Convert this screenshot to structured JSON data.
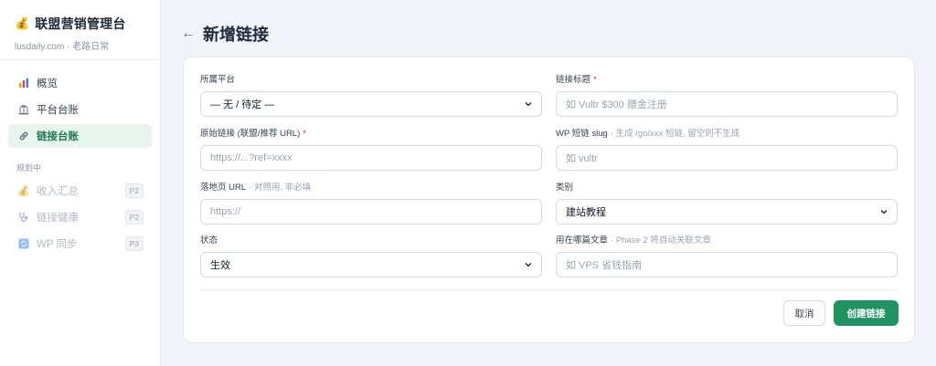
{
  "sidebar": {
    "brand": {
      "icon": "money-bag-icon",
      "title": "联盟营销管理台",
      "subtitle": "lusdaily.com · 老路日常"
    },
    "items": [
      {
        "label": "概览",
        "icon": "chart-icon",
        "active": false
      },
      {
        "label": "平台台账",
        "icon": "bank-icon",
        "active": false
      },
      {
        "label": "链接台账",
        "icon": "link-icon",
        "active": true
      }
    ],
    "section_label": "规划中",
    "planned_items": [
      {
        "label": "收入汇总",
        "icon": "money-bag-icon",
        "badge": "P2"
      },
      {
        "label": "链接健康",
        "icon": "stethoscope-icon",
        "badge": "P2"
      },
      {
        "label": "WP 同步",
        "icon": "sync-icon",
        "badge": "P3"
      }
    ]
  },
  "header": {
    "back_symbol": "←",
    "title": "新增链接"
  },
  "form": {
    "platform": {
      "label": "所属平台",
      "value": "— 无 / 待定 —"
    },
    "link_title": {
      "label": "链接标题",
      "required": "*",
      "placeholder": "如 Vultr $300 赠金注册"
    },
    "original_url": {
      "label": "原始链接 (联盟/推荐 URL)",
      "required": "*",
      "placeholder": "https://...?ref=xxxx"
    },
    "wp_slug": {
      "label": "WP 短链 slug",
      "hint": "· 生成 /go/xxx 短链, 留空则不生成",
      "placeholder": "如 vultr"
    },
    "landing_url": {
      "label": "落地页 URL",
      "hint": "· 对照用, 非必填",
      "placeholder": "https://"
    },
    "category": {
      "label": "类别",
      "value": "建站教程"
    },
    "status": {
      "label": "状态",
      "value": "生效"
    },
    "article": {
      "label": "用在哪篇文章",
      "hint": "· Phase 2 将自动关联文章",
      "placeholder": "如 VPS 省钱指南"
    }
  },
  "buttons": {
    "cancel": "取消",
    "create": "创建链接"
  },
  "colors": {
    "accent": "#1f9462",
    "active_bg": "#e7f5ee",
    "required": "#e11d48"
  }
}
